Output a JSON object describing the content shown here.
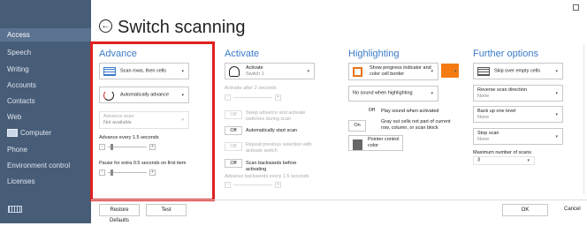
{
  "window": {
    "title": "Switch scanning"
  },
  "sidebar": {
    "items": [
      "Access",
      "Speech",
      "Writing",
      "Accounts",
      "Contacts",
      "Web",
      "Computer",
      "Phone",
      "Environment control",
      "Licenses"
    ]
  },
  "advance": {
    "title": "Advance",
    "scan_mode": "Scan rows, then cells",
    "advance_mode": "Automatically advance",
    "advance_scan_label": "Advance scan",
    "advance_scan_value": "Not available",
    "advance_every": "Advance every 1.5 seconds",
    "pause_extra": "Pause for extra 0.5 seconds on first item",
    "minus": "-",
    "plus": "+"
  },
  "activate": {
    "title": "Activate",
    "switch_label": "Activate",
    "switch_value": "Switch 1",
    "activate_after": "Activate after 2 seconds",
    "toggles": [
      {
        "state": "Off",
        "label": "Swap advance and activate switches during scan"
      },
      {
        "state": "Off",
        "label": "Automatically start scan"
      },
      {
        "state": "Off",
        "label": "Repeat previous selection with activate switch"
      },
      {
        "state": "Off",
        "label": "Scan backwards before activating"
      }
    ],
    "advance_backwards": "Advance backwards every 1.5 seconds"
  },
  "highlighting": {
    "title": "Highlighting",
    "indicator": "Show progress indicator and color cell border",
    "sound_dropdown": "No sound when highlighting",
    "toggles": [
      {
        "state": "Off",
        "label": "Play sound when activated"
      },
      {
        "state": "On",
        "label": "Gray out cells not part of current row, column, or scan block"
      }
    ],
    "pointer": "Pointer control color",
    "color_accent": "#f47b12"
  },
  "further": {
    "title": "Further options",
    "skip_empty": "Skip over empty cells",
    "reverse_label": "Reverse scan direction",
    "reverse_value": "None",
    "backup_label": "Back up one level",
    "backup_value": "None",
    "stop_label": "Stop scan",
    "stop_value": "None",
    "max_scans_label": "Maximum number of scans",
    "max_scans_value": "3"
  },
  "footer": {
    "restore_defaults": "Restore Defaults",
    "test": "Test",
    "ok": "OK",
    "cancel": "Cancel"
  },
  "colors": {
    "sidebar_bg": "#475c77",
    "accent_blue": "#3a7bc8",
    "highlight_red": "#e02020"
  }
}
